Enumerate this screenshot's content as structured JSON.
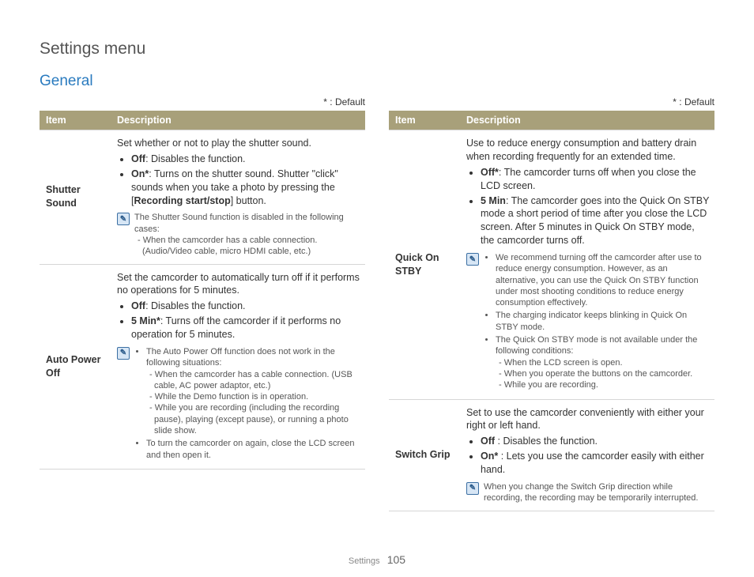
{
  "page_title": "Settings menu",
  "section_title": "General",
  "default_legend": "* : Default",
  "headers": {
    "item": "Item",
    "desc": "Description"
  },
  "footer": {
    "section": "Settings",
    "page": "105"
  },
  "left": [
    {
      "item": "Shutter Sound",
      "intro": "Set whether or not to play the shutter sound.",
      "bullets": [
        {
          "label": "Off",
          "text": ": Disables the function."
        },
        {
          "label": "On*",
          "text": ": Turns on the shutter sound. Shutter \"click\" sounds when you take a photo by pressing the [",
          "button": "Recording start/stop",
          "after": "] button."
        }
      ],
      "note": {
        "lead": "The Shutter Sound function is disabled in the following cases:",
        "lines": [
          "- When the camcorder has a cable connection. (Audio/Video cable, micro HDMI cable, etc.)"
        ]
      }
    },
    {
      "item": "Auto Power Off",
      "intro": "Set the camcorder to automatically turn off if it performs no operations for 5 minutes.",
      "bullets": [
        {
          "label": "Off",
          "text": ": Disables the function."
        },
        {
          "label": "5 Min*",
          "text": ": Turns off the camcorder if it performs no operation for 5 minutes."
        }
      ],
      "note_list": [
        {
          "lead": "The Auto Power Off function does not work in the following situations:",
          "lines": [
            "- When the camcorder has a cable connection. (USB cable, AC power adaptor, etc.)",
            "- While the Demo function is in operation.",
            "- While you are recording (including the recording pause), playing (except pause), or running a photo slide show."
          ]
        },
        {
          "lead": "To turn the camcorder on again, close the LCD screen and then open it.",
          "lines": []
        }
      ]
    }
  ],
  "right": [
    {
      "item": "Quick On STBY",
      "intro": "Use to reduce energy consumption and battery drain when recording frequently for an extended time.",
      "bullets": [
        {
          "label": "Off*",
          "text": ": The camcorder turns off when you close the LCD screen."
        },
        {
          "label": "5 Min",
          "text": ": The camcorder goes into the Quick On STBY mode a short period of time after you close the LCD screen. After 5 minutes in Quick On STBY mode, the camcorder turns off."
        }
      ],
      "note_list": [
        {
          "lead": "We recommend turning off the camcorder after use to reduce energy consumption. However, as an alternative, you can use the Quick On STBY function under most shooting conditions to reduce energy consumption effectively.",
          "lines": []
        },
        {
          "lead": "The charging indicator keeps blinking in Quick On STBY mode.",
          "lines": []
        },
        {
          "lead": "The Quick On STBY mode is not available under the following conditions:",
          "lines": [
            "- When the LCD screen is open.",
            "- When you operate the buttons on the camcorder.",
            "- While you are recording."
          ]
        }
      ]
    },
    {
      "item": "Switch Grip",
      "intro": "Set to use the camcorder conveniently with either your right or left hand.",
      "bullets": [
        {
          "label": "Off ",
          "text": ": Disables the function."
        },
        {
          "label": "On* ",
          "text": ": Lets you use the camcorder easily with either hand."
        }
      ],
      "note": {
        "lead": "When you change the Switch Grip direction while recording, the recording may be temporarily interrupted.",
        "lines": []
      }
    }
  ]
}
